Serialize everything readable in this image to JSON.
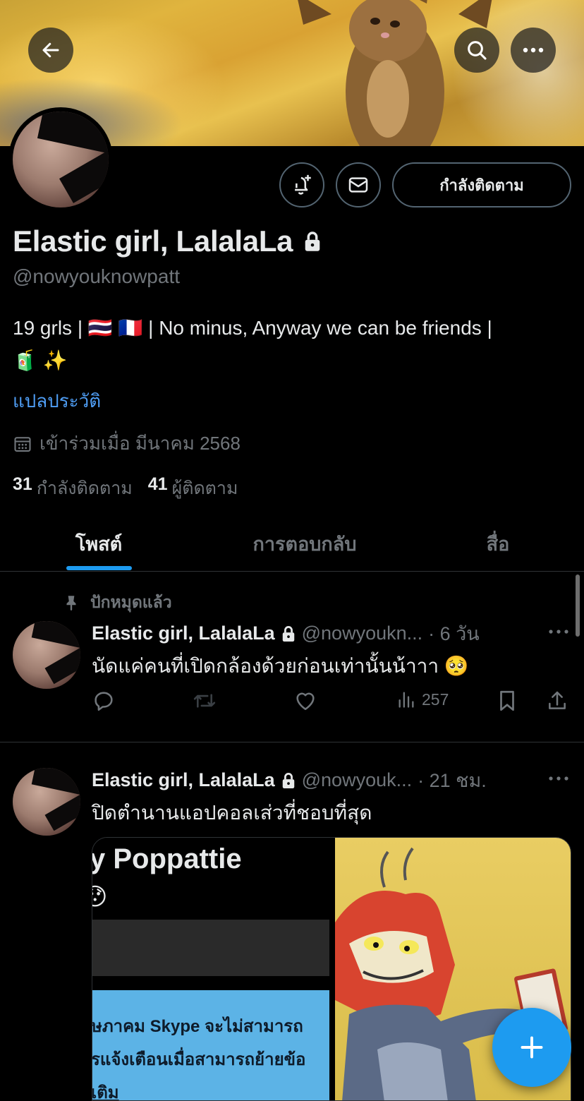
{
  "profile": {
    "display_name": "Elastic girl, LalalaLa",
    "handle": "@nowyouknowpatt",
    "bio_line1": "19 grls | 🇹🇭 🇫🇷 | No minus, Anyway we can be friends |",
    "bio_line2": "🧃 ✨",
    "translate_bio": "แปลประวัติ",
    "joined": "เข้าร่วมเมื่อ มีนาคม 2568",
    "following_count": "31",
    "following_label": "กำลังติดตาม",
    "followers_count": "41",
    "followers_label": "ผู้ติดตาม",
    "follow_state_button": "กำลังติดตาม"
  },
  "tabs": [
    {
      "label": "โพสต์",
      "active": true
    },
    {
      "label": "การตอบกลับ",
      "active": false
    },
    {
      "label": "สื่อ",
      "active": false
    }
  ],
  "pinned_label": "ปักหมุดแล้ว",
  "tweets": [
    {
      "name": "Elastic girl, LalalaLa",
      "handle": "@nowyoukn...",
      "time": "· 6 วัน",
      "text": "นัดแค่คนที่เปิดกล้องด้วยก่อนเท่านั้นน้าาา 🥺",
      "views": "257"
    },
    {
      "name": "Elastic girl, LalalaLa",
      "handle": "@nowyouk...",
      "time": "· 21 ชม.",
      "text": "ปิดตำนานแอปคอลเส่วที่ชอบที่สุด",
      "media_screenshot": {
        "title": "y Poppattie",
        "emoji": "😯",
        "line1": "ษภาคม Skype จะไม่สามารถ",
        "line2": "รแจ้งเตือนเมื่อสามารถย้ายข้อ",
        "line3": "เติม"
      }
    }
  ],
  "colors": {
    "accent": "#1d9bf0",
    "link": "#4f9ef5",
    "secondary_text": "#71767b",
    "divider": "#2f3336"
  },
  "icons": [
    "back-arrow-icon",
    "search-icon",
    "more-icon",
    "notification-bell-plus-icon",
    "mail-icon",
    "lock-icon",
    "calendar-icon",
    "pin-icon",
    "reply-icon",
    "retweet-icon",
    "like-icon",
    "views-icon",
    "bookmark-icon",
    "share-icon",
    "compose-plus-icon"
  ]
}
